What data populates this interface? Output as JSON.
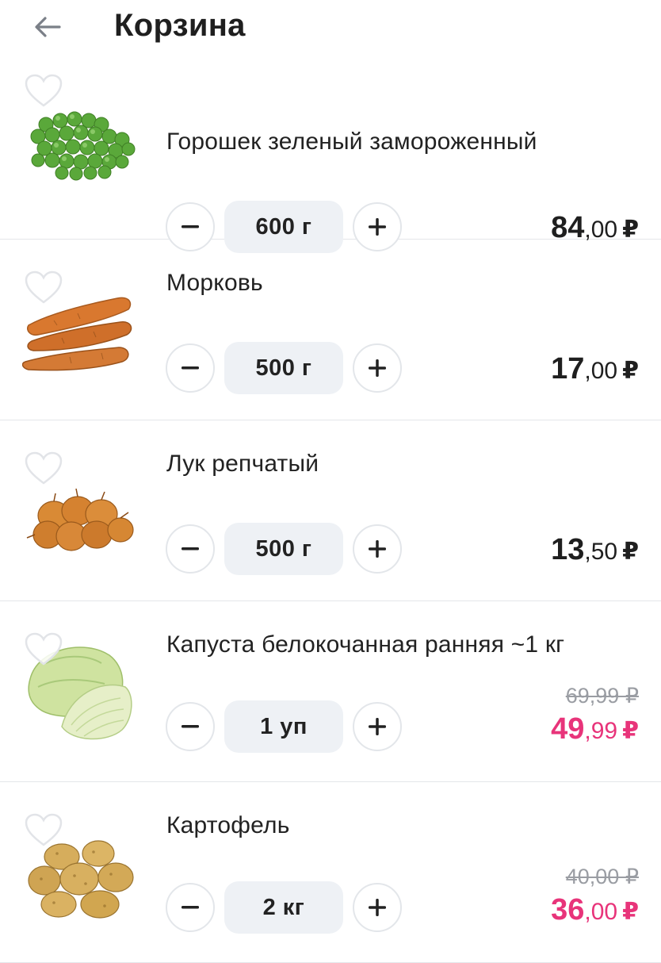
{
  "header": {
    "title": "Корзина",
    "back_icon": "arrow-left-icon"
  },
  "items": [
    {
      "name": "Горошек зеленый замороженный",
      "qty": "600 г",
      "price_int": "84",
      "price_dec": ",00",
      "currency": "₽",
      "image": "peas-image"
    },
    {
      "name": "Морковь",
      "qty": "500 г",
      "price_int": "17",
      "price_dec": ",00",
      "currency": "₽",
      "image": "carrot-image"
    },
    {
      "name": "Лук репчатый",
      "qty": "500 г",
      "price_int": "13",
      "price_dec": ",50",
      "currency": "₽",
      "image": "onion-image"
    },
    {
      "name": "Капуста белокочанная ранняя ~1 кг",
      "qty": "1 уп",
      "old_price": "69,99 ₽",
      "price_int": "49",
      "price_dec": ",99",
      "currency": "₽",
      "image": "cabbage-image"
    },
    {
      "name": "Картофель",
      "qty": "2 кг",
      "old_price": "40,00 ₽",
      "price_int": "36",
      "price_dec": ",00",
      "currency": "₽",
      "image": "potato-image"
    }
  ],
  "colors": {
    "sale": "#e8347a",
    "divider": "#e4e6ea",
    "qty_bg": "#eef1f5",
    "text": "#1f1f1f"
  }
}
